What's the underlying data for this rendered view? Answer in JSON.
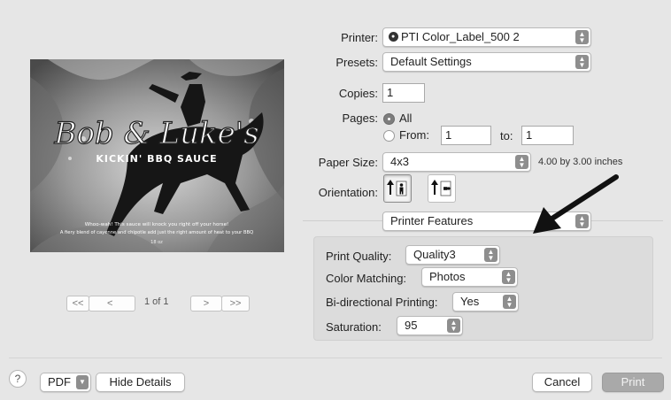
{
  "preview": {
    "brand_title": "Bob & Luke's",
    "brand_subtitle": "KICKIN' BBQ SAUCE",
    "tagline_1": "Whoo-wah! This sauce will knock you right off your horse!",
    "tagline_2": "A fiery blend of cayenne and chipotle add just the right amount of heat to your BBQ",
    "net_weight": "18 oz",
    "nav_first": "<<",
    "nav_prev": "<",
    "page_indicator": "1 of 1",
    "nav_next": ">",
    "nav_last": ">>"
  },
  "settings": {
    "printer_label": "Printer:",
    "printer_value": "PTI Color_Label_500 2",
    "presets_label": "Presets:",
    "presets_value": "Default Settings",
    "copies_label": "Copies:",
    "copies_value": "1",
    "pages_label": "Pages:",
    "pages_all": "All",
    "pages_from": "From:",
    "pages_from_value": "1",
    "pages_to": "to:",
    "pages_to_value": "1",
    "paper_size_label": "Paper Size:",
    "paper_size_value": "4x3",
    "paper_size_desc": "4.00 by 3.00 inches",
    "orientation_label": "Orientation:",
    "section_value": "Printer Features"
  },
  "features": {
    "print_quality_label": "Print Quality:",
    "print_quality_value": "Quality3",
    "color_matching_label": "Color Matching:",
    "color_matching_value": "Photos",
    "bidirectional_label": "Bi-directional Printing:",
    "bidirectional_value": "Yes",
    "saturation_label": "Saturation:",
    "saturation_value": "95"
  },
  "footer": {
    "help": "?",
    "pdf": "PDF",
    "hide_details": "Hide Details",
    "cancel": "Cancel",
    "print": "Print"
  },
  "colors": {
    "window_bg": "#e6e6e6",
    "panel_bg": "#dcdcdc",
    "print_button_bg": "#a9a9a9",
    "annotation_arrow": "#111111"
  },
  "icons": {
    "portrait": "portrait-orientation-icon",
    "landscape": "landscape-orientation-icon",
    "printer_status": "printer-status-icon",
    "arrow": "annotation-arrow-icon"
  }
}
